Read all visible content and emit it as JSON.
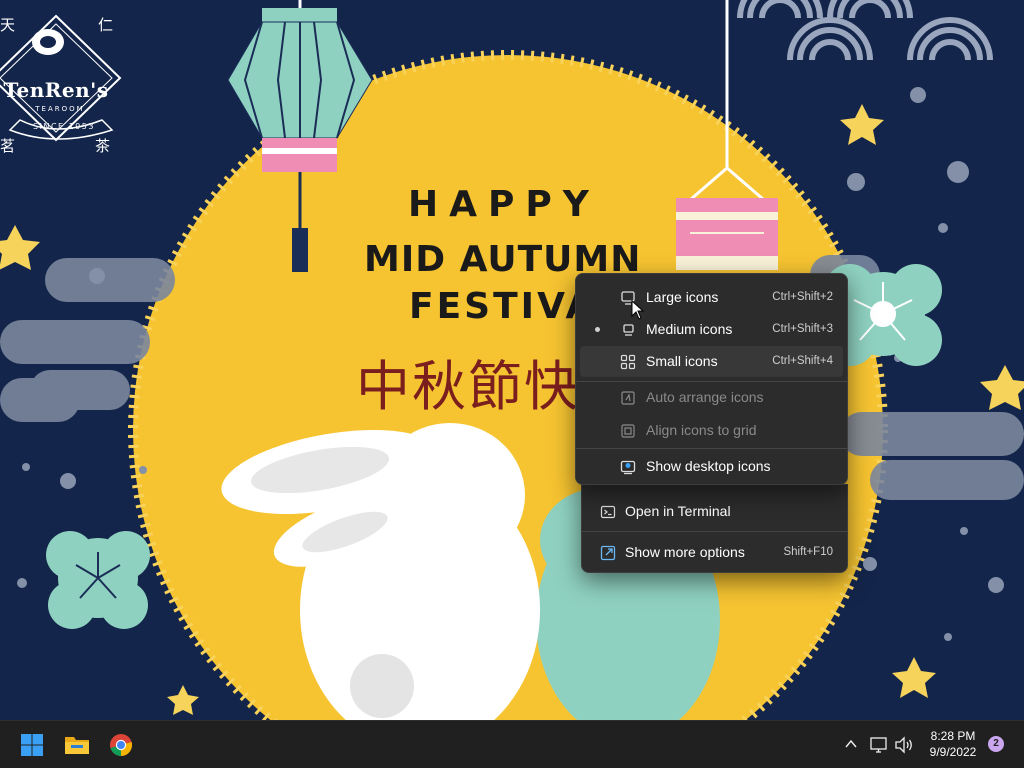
{
  "wallpaper": {
    "logo": {
      "name": "TenRen's",
      "subtitle": "TEAROOM",
      "since": "SINCE 1953",
      "corner_tl": "天",
      "corner_tr": "仁",
      "corner_bl": "茗",
      "corner_br": "茶"
    },
    "greeting": {
      "line1": "HAPPY",
      "line2": "MID AUTUMN",
      "line3": "FESTIVA",
      "chinese": "中秋節快"
    }
  },
  "context_menu": {
    "view_submenu": [
      {
        "label": "Large icons",
        "shortcut": "Ctrl+Shift+2",
        "icon": "large-icons-icon"
      },
      {
        "label": "Medium icons",
        "shortcut": "Ctrl+Shift+3",
        "icon": "medium-icons-icon",
        "selected": true
      },
      {
        "label": "Small icons",
        "shortcut": "Ctrl+Shift+4",
        "icon": "small-icons-icon",
        "hovered": true
      },
      {
        "label": "Auto arrange icons",
        "icon": "auto-arrange-icon",
        "disabled": true
      },
      {
        "label": "Align icons to grid",
        "icon": "align-grid-icon",
        "disabled": true
      },
      {
        "label": "Show desktop icons",
        "icon": "show-desktop-icons-icon"
      }
    ],
    "main": [
      {
        "label": "Open in Terminal",
        "icon": "terminal-icon"
      },
      {
        "label": "Show more options",
        "shortcut": "Shift+F10",
        "icon": "more-options-icon"
      }
    ]
  },
  "taskbar": {
    "apps": [
      "start-icon",
      "file-explorer-icon",
      "chrome-icon"
    ],
    "tray": {
      "time": "8:28 PM",
      "date": "9/9/2022",
      "notification_count": "2"
    }
  },
  "colors": {
    "sky": "#13254a",
    "moon": "#f6c431",
    "menu_bg": "#2c2c2c",
    "taskbar": "#202020",
    "accent_blue": "#3aa0f5"
  }
}
